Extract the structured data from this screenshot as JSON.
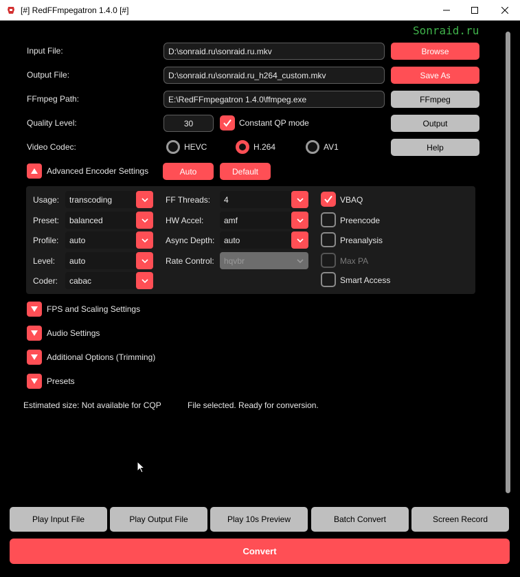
{
  "window": {
    "title": "[#] RedFFmpegatron 1.4.0 [#]"
  },
  "watermark": "Sonraid.ru",
  "main": {
    "input_label": "Input File:",
    "input_value": "D:\\sonraid.ru\\sonraid.ru.mkv",
    "output_label": "Output File:",
    "output_value": "D:\\sonraid.ru\\sonraid.ru_h264_custom.mkv",
    "ffmpeg_label": "FFmpeg Path:",
    "ffmpeg_value": "E:\\RedFFmpegatron 1.4.0\\ffmpeg.exe",
    "quality_label": "Quality Level:",
    "quality_value": "30",
    "cqp_label": "Constant QP mode",
    "codec_label": "Video Codec:",
    "codecs": [
      "HEVC",
      "H.264",
      "AV1"
    ],
    "selected_codec": "H.264"
  },
  "side_buttons": {
    "browse": "Browse",
    "save_as": "Save As",
    "ffmpeg": "FFmpeg",
    "output": "Output",
    "help": "Help"
  },
  "advanced": {
    "header": "Advanced Encoder Settings",
    "auto": "Auto",
    "default": "Default",
    "usage_label": "Usage:",
    "usage": "transcoding",
    "preset_label": "Preset:",
    "preset": "balanced",
    "profile_label": "Profile:",
    "profile": "auto",
    "level_label": "Level:",
    "level": "auto",
    "coder_label": "Coder:",
    "coder": "cabac",
    "threads_label": "FF Threads:",
    "threads": "4",
    "hwaccel_label": "HW Accel:",
    "hwaccel": "amf",
    "async_label": "Async Depth:",
    "async": "auto",
    "rate_label": "Rate Control:",
    "rate": "hqvbr",
    "vbaq": "VBAQ",
    "preencode": "Preencode",
    "preanalysis": "Preanalysis",
    "max_pa": "Max PA",
    "smart_access": "Smart Access"
  },
  "sections": {
    "fps": "FPS and Scaling Settings",
    "audio": "Audio Settings",
    "additional": "Additional Options (Trimming)",
    "presets": "Presets"
  },
  "status": {
    "estimated": "Estimated size: Not available for CQP",
    "message": "File selected. Ready for conversion."
  },
  "bottom": {
    "play_input": "Play Input File",
    "play_output": "Play Output File",
    "play_preview": "Play 10s Preview",
    "batch": "Batch Convert",
    "screen_record": "Screen Record",
    "convert": "Convert"
  },
  "colors": {
    "accent": "#ff4f55",
    "button_grey": "#bfbfbf",
    "watermark": "#3fb24a"
  }
}
